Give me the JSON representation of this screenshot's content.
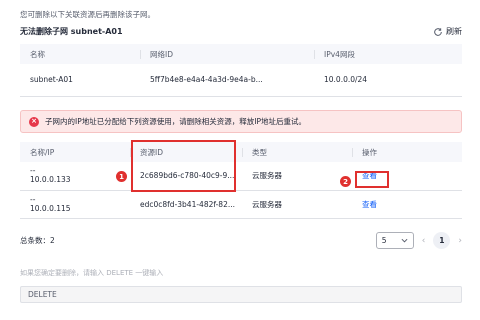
{
  "hint": "您可删除以下关联资源后再删除该子网。",
  "subtitle": "无法删除子网 subnet-A01",
  "refresh": {
    "label": "刷新",
    "icon": "refresh-icon"
  },
  "subnet_table": {
    "headers": [
      "名称",
      "网络ID",
      "IPv4网段"
    ],
    "rows": [
      {
        "name": "subnet-A01",
        "network_id": "5ff7b4e8-e4a4-4a3d-9e4a-b...",
        "cidr": "10.0.0.0/24"
      }
    ]
  },
  "alert": {
    "icon": "error-icon",
    "text": "子网内的IP地址已分配给下列资源使用，请删除相关资源，释放IP地址后重试。",
    "color": "#e6374a"
  },
  "resource_table": {
    "headers": [
      "名称/IP",
      "资源ID",
      "类型",
      "操作"
    ],
    "rows": [
      {
        "name": "--",
        "ip": "10.0.0.133",
        "resource_id": "2c689bd6-c780-40c9-9...",
        "type": "云服务器",
        "action": "查看"
      },
      {
        "name": "--",
        "ip": "10.0.0.115",
        "resource_id": "edc0c8fd-3b41-482f-82...",
        "type": "云服务器",
        "action": "查看"
      }
    ]
  },
  "annotations": {
    "m1": "1",
    "m2": "2",
    "color": "#e0302e"
  },
  "footer": {
    "total": "总条数：2",
    "page_size": "5",
    "current_page": "1"
  },
  "confirm": {
    "hint": "如果您确定要删除，请输入 DELETE    一键输入",
    "value": "DELETE"
  },
  "colors": {
    "link": "#0a59f7",
    "alert_bg": "#fde8e8"
  }
}
